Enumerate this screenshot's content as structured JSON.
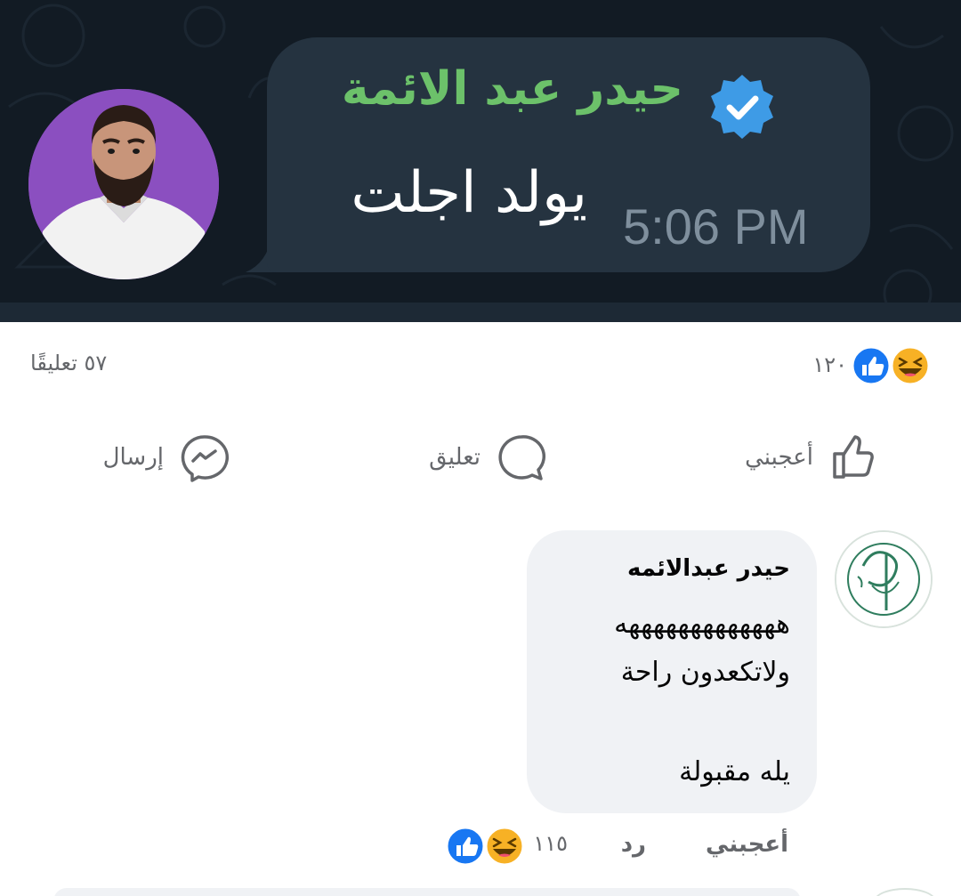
{
  "telegram_message": {
    "sender_name": "حيدر عبد الائمة",
    "text": "يولد اجلت",
    "time": "5:06 PM",
    "verified_icon": "verified-badge-icon",
    "colors": {
      "name": "#6cc16a",
      "bubble": "#253340",
      "background": "#121b24",
      "time": "#7f8f9d"
    }
  },
  "post_stats": {
    "reactions_count": "١٢٠",
    "reaction_icons": [
      "haha-icon",
      "like-icon"
    ],
    "comments_count": "٥٧ تعليقًا"
  },
  "post_actions": {
    "like_label": "أعجبني",
    "comment_label": "تعليق",
    "send_label": "إرسال"
  },
  "comment": {
    "author": "حيدر عبدالائمه",
    "lines": [
      "هههههههههههههه",
      "ولاتكعدون راحة",
      "يله مقبولة"
    ],
    "like_label": "أعجبني",
    "reply_label": "رد",
    "reactions_count": "١١٥",
    "reaction_icons": [
      "haha-icon",
      "like-icon"
    ]
  },
  "colors": {
    "facebook_blue": "#1877f2",
    "haha_yellow": "#f7b125",
    "secondary_text": "#65676b",
    "comment_bubble": "#f0f2f5"
  }
}
